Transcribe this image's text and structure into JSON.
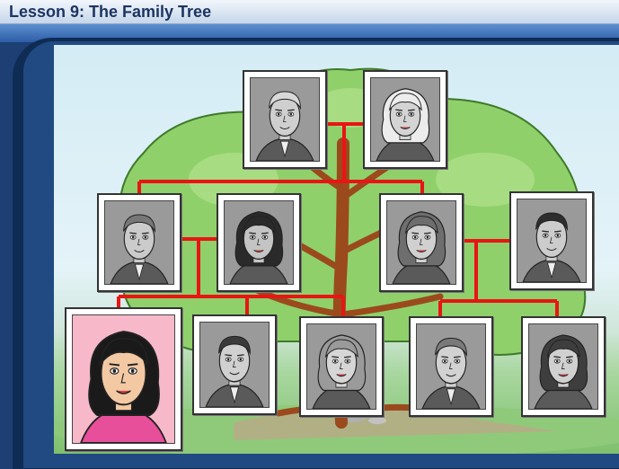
{
  "header": {
    "title": "Lesson 9: The Family Tree"
  },
  "tree": {
    "connector_color": "#e81515",
    "people": [
      {
        "id": "grandfather",
        "hair": "#d8d8d8",
        "skin": "#cfcfcf",
        "gender": "male",
        "selected": false
      },
      {
        "id": "grandmother",
        "hair": "#ececec",
        "skin": "#d4d4d4",
        "gender": "female",
        "selected": false
      },
      {
        "id": "father",
        "hair": "#777777",
        "skin": "#cbcbcb",
        "gender": "male",
        "selected": false
      },
      {
        "id": "mother",
        "hair": "#2a2a2a",
        "skin": "#c4c4c4",
        "gender": "female",
        "selected": false
      },
      {
        "id": "aunt",
        "hair": "#6e6e6e",
        "skin": "#d0d0d0",
        "gender": "female",
        "selected": false
      },
      {
        "id": "uncle",
        "hair": "#2e2e2e",
        "skin": "#cccccc",
        "gender": "male",
        "selected": false
      },
      {
        "id": "girl-selected",
        "hair": "#1a1a1a",
        "skin": "#f3c9a4",
        "gender": "female",
        "selected": true
      },
      {
        "id": "boy",
        "hair": "#3a3a3a",
        "skin": "#d0d0d0",
        "gender": "male",
        "selected": false
      },
      {
        "id": "girl-blonde",
        "hair": "#9a9a9a",
        "skin": "#d6d6d6",
        "gender": "female",
        "selected": false
      },
      {
        "id": "cousin-boy",
        "hair": "#7a7a7a",
        "skin": "#d2d2d2",
        "gender": "male",
        "selected": false
      },
      {
        "id": "cousin-girl",
        "hair": "#3e3e3e",
        "skin": "#d0d0d0",
        "gender": "female",
        "selected": false
      }
    ]
  }
}
